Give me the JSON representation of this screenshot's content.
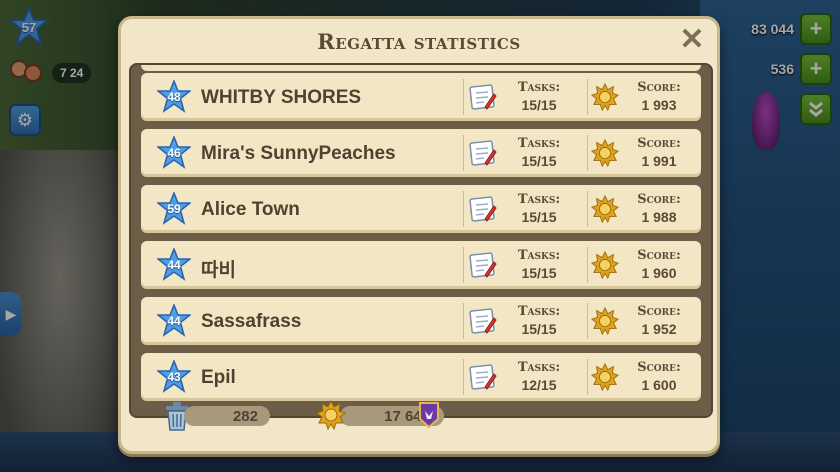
{
  "hud": {
    "level": "57",
    "population": "7 24",
    "coins": "83 044",
    "gems": "536"
  },
  "dialog": {
    "title": "Regatta statistics",
    "tasks_label": "Tasks:",
    "score_label": "Score:"
  },
  "rows": [
    {
      "level": "48",
      "name": "WHITBY SHORES",
      "tasks": "15/15",
      "score": "1 993"
    },
    {
      "level": "46",
      "name": "Mira's SunnyPeaches",
      "tasks": "15/15",
      "score": "1 991"
    },
    {
      "level": "59",
      "name": "Alice Town",
      "tasks": "15/15",
      "score": "1 988"
    },
    {
      "level": "44",
      "name": "따비",
      "tasks": "15/15",
      "score": "1 960"
    },
    {
      "level": "44",
      "name": "Sassafrass",
      "tasks": "15/15",
      "score": "1 952"
    },
    {
      "level": "43",
      "name": "Epil",
      "tasks": "12/15",
      "score": "1 600"
    }
  ],
  "footer": {
    "trash_count": "282",
    "total_score": "17 649"
  },
  "colors": {
    "badge_blue": "#4f9de6",
    "plus_green": "#5fa82a",
    "dialog_bg": "#f2e6c8",
    "frame_brown": "#6b5d47",
    "emblem_purple": "#6a3aa8"
  }
}
